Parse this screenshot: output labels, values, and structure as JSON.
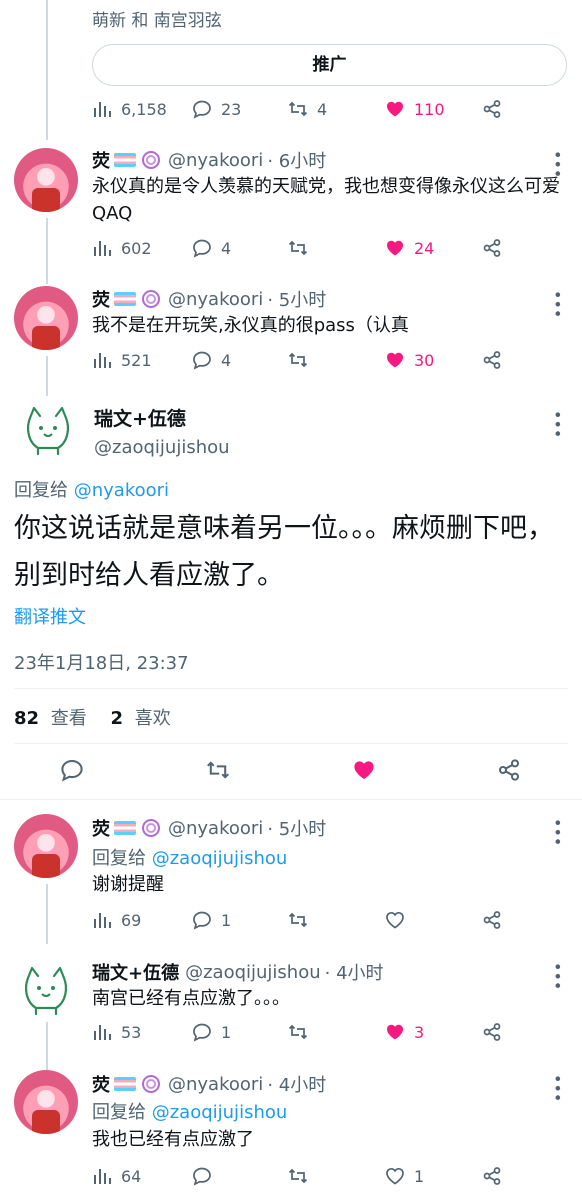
{
  "top": {
    "context": "萌新 和 南宫羽弦",
    "promote_label": "推广",
    "views": "6,158",
    "replies": "23",
    "retweets": "4",
    "likes": "110"
  },
  "tweets": [
    {
      "name": "荧",
      "handle": "@nyakoori",
      "time": "· 6小时",
      "text": "永仪真的是令人羡慕的天赋党，我也想变得像永仪这么可爱QAQ",
      "views": "602",
      "replies": "4",
      "retweets": "",
      "likes": "24"
    },
    {
      "name": "荧",
      "handle": "@nyakoori",
      "time": "· 5小时",
      "text": "我不是在开玩笑,永仪真的很pass（认真",
      "views": "521",
      "replies": "4",
      "retweets": "",
      "likes": "30"
    }
  ],
  "focus": {
    "name": "瑞文+伍德",
    "handle": "@zaoqijujishou",
    "reply_prefix": "回复给",
    "reply_to": "@nyakoori",
    "text": "你这说话就是意味着另一位。。。麻烦删下吧，别到时给人看应激了。",
    "translate": "翻译推文",
    "timestamp": "23年1月18日, 23:37",
    "views_count": "82",
    "views_label": "查看",
    "likes_count": "2",
    "likes_label": "喜欢"
  },
  "replies": [
    {
      "name": "荧",
      "handle": "@nyakoori",
      "time": "· 5小时",
      "reply_prefix": "回复给",
      "reply_to": "@zaoqijujishou",
      "text": "谢谢提醒",
      "views": "69",
      "replies": "1",
      "retweets": "",
      "likes": ""
    },
    {
      "name": "瑞文+伍德",
      "handle": "@zaoqijujishou",
      "time": "· 4小时",
      "text": "南宫已经有点应激了。。。",
      "views": "53",
      "replies": "1",
      "retweets": "",
      "likes": "3"
    },
    {
      "name": "荧",
      "handle": "@nyakoori",
      "time": "· 4小时",
      "reply_prefix": "回复给",
      "reply_to": "@zaoqijujishou",
      "text": "我也已经有点应激了",
      "views": "64",
      "replies": "",
      "retweets": "",
      "likes": "1"
    }
  ],
  "colors": {
    "like_pink": "#f91880",
    "link_blue": "#1d9bf0",
    "muted": "#536471"
  }
}
